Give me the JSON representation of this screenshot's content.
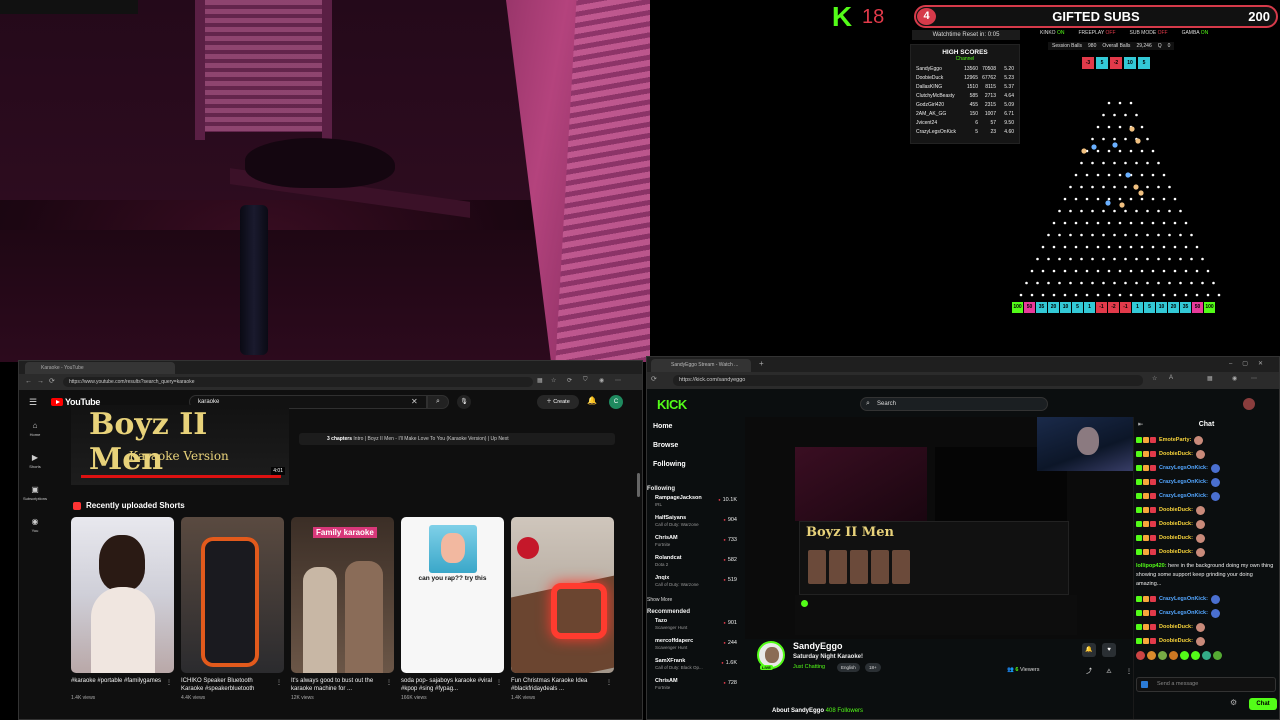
{
  "plinko": {
    "counter": "18",
    "gifted": {
      "badge": "4",
      "label": "GIFTED SUBS",
      "value": "200"
    },
    "watch_reset": "Watchtime Reset in: 0:05",
    "flags": [
      {
        "name": "KINKO",
        "state": "ON",
        "on": true
      },
      {
        "name": "FREEPLAY",
        "state": "OFF",
        "on": false
      },
      {
        "name": "SUB MODE",
        "state": "OFF",
        "on": false
      },
      {
        "name": "GAMBA",
        "state": "ON",
        "on": true
      }
    ],
    "balls": {
      "session_label": "Session Balls",
      "session": "980",
      "overall_label": "Overall Balls",
      "overall": "29,246",
      "q_label": "Q",
      "q": "0"
    },
    "high_scores": {
      "title": "HIGH SCORES",
      "subtitle": "Channel",
      "rows": [
        {
          "name": "SandyEggo",
          "a": "13560",
          "b": "70508",
          "c": "5.20"
        },
        {
          "name": "DoobieDuck",
          "a": "12965",
          "b": "67762",
          "c": "5.23"
        },
        {
          "name": "DallasKING",
          "a": "1510",
          "b": "8115",
          "c": "5.37"
        },
        {
          "name": "ClutchyMcBeasty",
          "a": "585",
          "b": "2713",
          "c": "4.64"
        },
        {
          "name": "GodzGirl420",
          "a": "455",
          "b": "2315",
          "c": "5.09"
        },
        {
          "name": "2AM_AK_GG",
          "a": "150",
          "b": "1007",
          "c": "6.71"
        },
        {
          "name": "Jvicent24",
          "a": "6",
          "b": "57",
          "c": "9.50"
        },
        {
          "name": "CrazyLegsOnKick",
          "a": "5",
          "b": "23",
          "c": "4.60"
        }
      ]
    },
    "top_slots": [
      {
        "label": "-3",
        "color": "#e23a4a"
      },
      {
        "label": "5",
        "color": "#33c9d6"
      },
      {
        "label": "-2",
        "color": "#e23a4a"
      },
      {
        "label": "10",
        "color": "#33c9d6"
      },
      {
        "label": "5",
        "color": "#33c9d6"
      }
    ],
    "bottom_slots": [
      {
        "label": "100",
        "color": "#53fc18"
      },
      {
        "label": "50",
        "color": "#e83a9a"
      },
      {
        "label": "35",
        "color": "#33c9d6"
      },
      {
        "label": "20",
        "color": "#33c9d6"
      },
      {
        "label": "10",
        "color": "#33c9d6"
      },
      {
        "label": "5",
        "color": "#33c9d6"
      },
      {
        "label": "1",
        "color": "#33c9d6"
      },
      {
        "label": "-1",
        "color": "#e23a4a"
      },
      {
        "label": "-2",
        "color": "#e23a4a"
      },
      {
        "label": "-1",
        "color": "#e23a4a"
      },
      {
        "label": "1",
        "color": "#33c9d6"
      },
      {
        "label": "5",
        "color": "#33c9d6"
      },
      {
        "label": "10",
        "color": "#33c9d6"
      },
      {
        "label": "20",
        "color": "#33c9d6"
      },
      {
        "label": "35",
        "color": "#33c9d6"
      },
      {
        "label": "50",
        "color": "#e83a9a"
      },
      {
        "label": "100",
        "color": "#53fc18"
      }
    ]
  },
  "youtube": {
    "tab_title": "Karaoke - YouTube",
    "url": "https://www.youtube.com/results?search_query=karaoke",
    "logo": "YouTube",
    "search_value": "karaoke",
    "create_label": "Create",
    "avatar_letter": "C",
    "rail": [
      {
        "label": "Home",
        "icon": "⌂"
      },
      {
        "label": "Shorts",
        "icon": "▶"
      },
      {
        "label": "Subscriptions",
        "icon": "▣"
      },
      {
        "label": "You",
        "icon": "◉"
      }
    ],
    "hero": {
      "title": "Boyz II Men",
      "subtitle": "Karaoke Version",
      "duration": "4:01"
    },
    "chapters": {
      "count": "3 chapters",
      "text": "Intro | Boyz II Men - I'll Make Love To You (Karaoke Version) | Up Next"
    },
    "shorts_heading": "Recently uploaded Shorts",
    "shorts": [
      {
        "title": "#karaoke #portable #familygames",
        "views": "1.4K views",
        "cls": "t1"
      },
      {
        "title": "ICHIKO Speaker Bluetooth Karaoke #speakerbluetooth",
        "views": "4.4K views",
        "cls": "t2"
      },
      {
        "title": "It's always good to bust out the karaoke machine for ...",
        "views": "12K views",
        "cls": "t3",
        "overlay": "Family karaoke"
      },
      {
        "title": "soda pop- sajaboys karaoke #viral #kpop #sing #fypag...",
        "views": "166K views",
        "cls": "t4",
        "overlay": "can you rap?? try this"
      },
      {
        "title": "Fun Christmas Karaoke Idea #blackfridaydeals ...",
        "views": "1.4K views",
        "cls": "t5"
      }
    ]
  },
  "kick": {
    "tab_title": "SandyEggo Stream - Watch ...",
    "url": "https://kick.com/sandyeggo",
    "logo": "KICK",
    "search_placeholder": "Search",
    "nav": [
      "Home",
      "Browse",
      "Following"
    ],
    "following_label": "Following",
    "following": [
      {
        "name": "RampageJackson",
        "game": "IRL",
        "count": "10.1K"
      },
      {
        "name": "HalfSaiyans",
        "game": "Call of Duty: Warzone",
        "count": "904"
      },
      {
        "name": "ChrisAM",
        "game": "Fortnite",
        "count": "733"
      },
      {
        "name": "Rolandcat",
        "game": "Dota 2",
        "count": "582"
      },
      {
        "name": "Jnqix",
        "game": "Call of Duty: Warzone",
        "count": "519"
      }
    ],
    "show_more": "Show More",
    "recommended_label": "Recommended",
    "recommended": [
      {
        "name": "Tazo",
        "game": "Scavenger Hunt",
        "count": "901"
      },
      {
        "name": "mercoffdaperc",
        "game": "Scavenger Hunt",
        "count": "244"
      },
      {
        "name": "SamXFrank",
        "game": "Call of Duty: Black Op...",
        "count": "1.6K"
      },
      {
        "name": "ChrisAM",
        "game": "Fortnite",
        "count": "728"
      }
    ],
    "streamer": {
      "name": "SandyEggo",
      "title": "Saturday Night Karaoke!",
      "category": "Just Chatting",
      "tags": [
        "English",
        "18+"
      ],
      "viewers": "6",
      "viewers_label": "Viewers",
      "live": "LIVE"
    },
    "about": {
      "label": "About SandyEggo",
      "followers": "408",
      "followers_label": "Followers"
    },
    "chat": {
      "title": "Chat",
      "messages": [
        {
          "user": "EmoteParty:",
          "color": "#f7d33a"
        },
        {
          "user": "DoobieDuck:",
          "color": "#f7d33a"
        },
        {
          "user": "CrazyLegsOnKick:",
          "color": "#53a6ff"
        },
        {
          "user": "CrazyLegsOnKick:",
          "color": "#53a6ff"
        },
        {
          "user": "CrazyLegsOnKick:",
          "color": "#53a6ff"
        },
        {
          "user": "DoobieDuck:",
          "color": "#f7d33a"
        },
        {
          "user": "DoobieDuck:",
          "color": "#f7d33a"
        },
        {
          "user": "DoobieDuck:",
          "color": "#f7d33a"
        },
        {
          "user": "DoobieDuck:",
          "color": "#f7d33a"
        }
      ],
      "long_msg": {
        "user": "lollipop420:",
        "text": "here in the background doing my own thing showing some support keep grinding your doing amazing..."
      },
      "messages2": [
        {
          "user": "CrazyLegsOnKick:",
          "color": "#53a6ff"
        },
        {
          "user": "CrazyLegsOnKick:",
          "color": "#53a6ff"
        },
        {
          "user": "DoobieDuck:",
          "color": "#f7d33a"
        },
        {
          "user": "DoobieDuck:",
          "color": "#f7d33a"
        }
      ],
      "input_placeholder": "Send a message",
      "send_label": "Chat"
    }
  }
}
